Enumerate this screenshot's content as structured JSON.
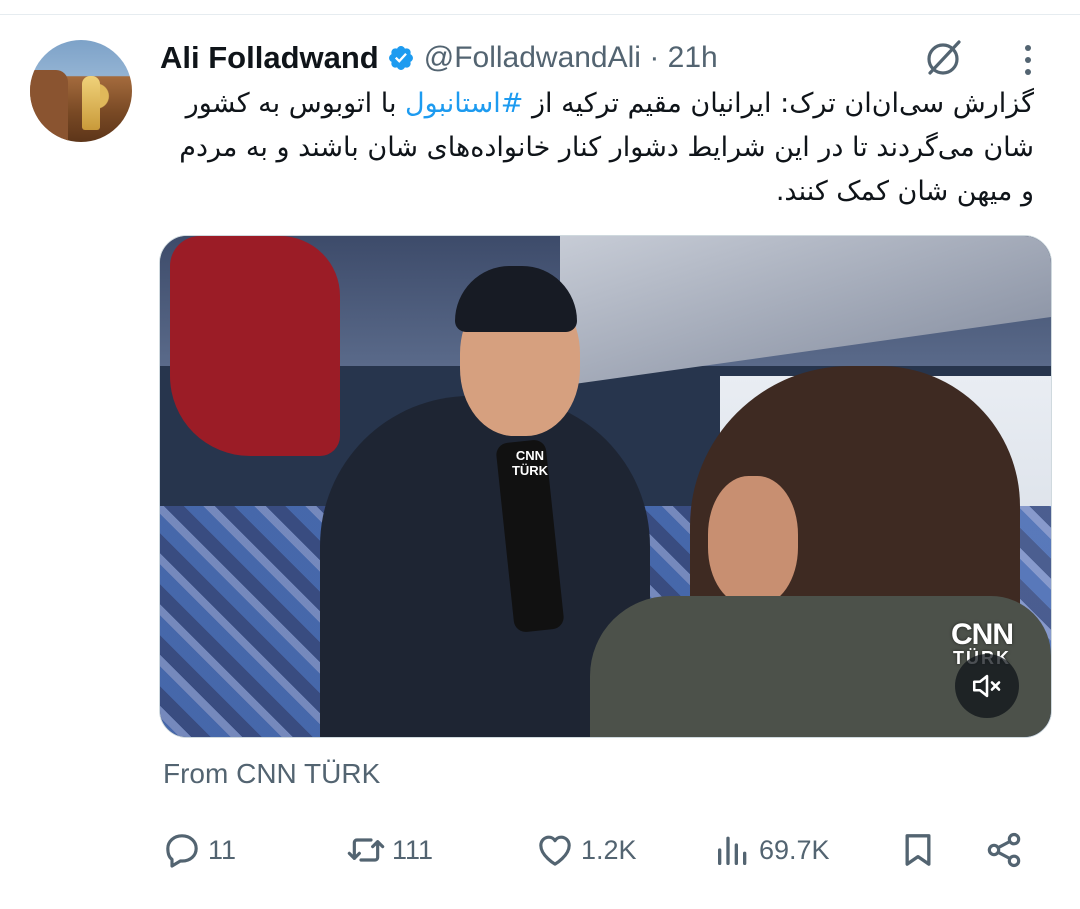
{
  "tweet": {
    "author_name": "Ali Folladwand",
    "handle": "@FolladwandAli",
    "separator": "·",
    "time": "21h",
    "text_before_hashtag": "گزارش سی‌ان‌ان ترک: ایرانیان مقیم ترکیه از ",
    "hashtag": "#استانبول",
    "text_after_hashtag": " با اتوبوس به کشور شان می‌گردند تا در این شرایط دشوار کنار خانواده‌های شان باشند و به مردم و میهن شان کمک کنند.",
    "media": {
      "mic_label_1": "CNN",
      "mic_label_2": "TÜRK",
      "channel_logo_1": "CNN",
      "channel_logo_2": "TÜRK",
      "mute_icon": "speaker-muted-icon"
    },
    "source": "From CNN TÜRK"
  },
  "actions": {
    "replies": "11",
    "reposts": "111",
    "likes": "1.2K",
    "views": "69.7K"
  },
  "colors": {
    "accent": "#1d9bf0",
    "secondary_text": "#536471",
    "primary_text": "#0f1419"
  }
}
